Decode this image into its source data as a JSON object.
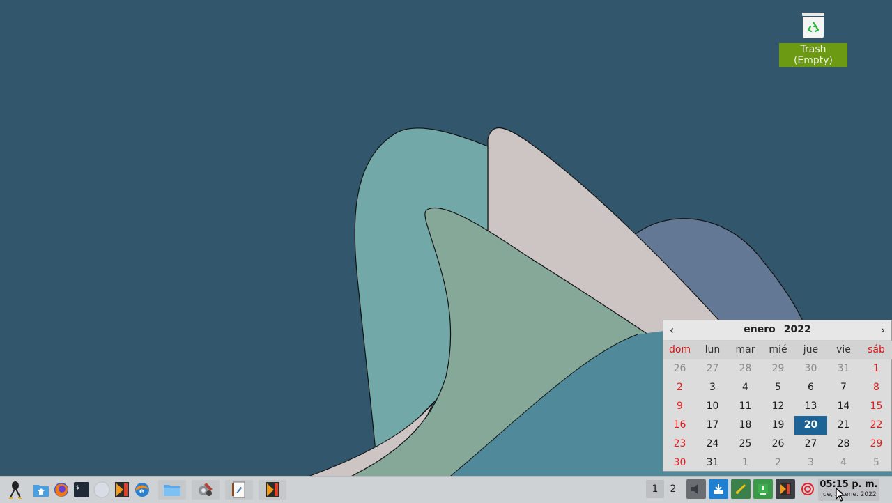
{
  "desktop": {
    "trash_label": "Trash (Empty)",
    "trash_icon": "trash-icon"
  },
  "calendar": {
    "month": "enero",
    "year": "2022",
    "prev": "‹",
    "next": "›",
    "weekdays": [
      "dom",
      "lun",
      "mar",
      "mié",
      "jue",
      "vie",
      "sáb"
    ],
    "today": "20",
    "weeks": [
      [
        "26",
        "27",
        "28",
        "29",
        "30",
        "31",
        "1"
      ],
      [
        "2",
        "3",
        "4",
        "5",
        "6",
        "7",
        "8"
      ],
      [
        "9",
        "10",
        "11",
        "12",
        "13",
        "14",
        "15"
      ],
      [
        "16",
        "17",
        "18",
        "19",
        "20",
        "21",
        "22"
      ],
      [
        "23",
        "24",
        "25",
        "26",
        "27",
        "28",
        "29"
      ],
      [
        "30",
        "31",
        "1",
        "2",
        "3",
        "4",
        "5"
      ]
    ],
    "colors": {
      "today": "#1d6396",
      "weekend": "#e01b1b",
      "other_month": "#8a8a8a"
    }
  },
  "taskbar": {
    "launchers": [
      "menu-icon",
      "home-folder-icon",
      "firefox-icon",
      "terminal-icon",
      "globe-icon",
      "media-icon",
      "browser-icon",
      "folder-icon",
      "settings-icon",
      "document-icon",
      "media-window-icon"
    ],
    "workspaces": [
      "1",
      "2"
    ],
    "active_workspace": "1",
    "tray": [
      "volume-icon",
      "updates-icon",
      "network-icon",
      "download-icon",
      "media-tray-icon",
      "power-icon"
    ],
    "clock": {
      "time": "05:15 p. m.",
      "date": "jue, 20 ene. 2022"
    }
  }
}
